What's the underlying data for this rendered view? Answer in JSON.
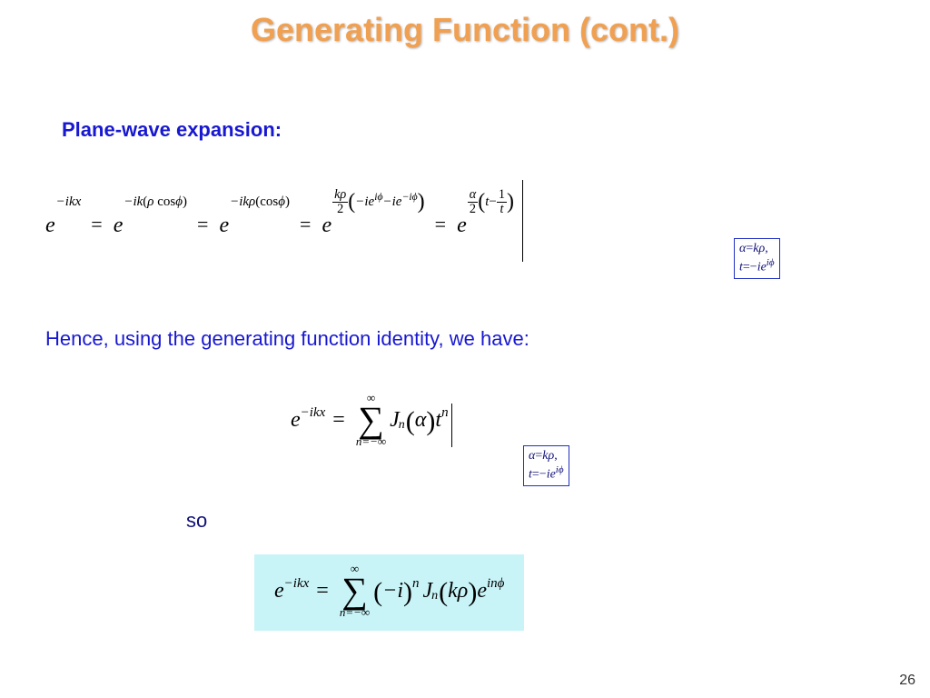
{
  "title": "Generating Function (cont.)",
  "subheading": "Plane-wave expansion:",
  "body_text": "Hence, using the generating function identity, we have:",
  "so": "so",
  "page_number": "26",
  "bullet": "",
  "eq1": {
    "t1_base": "e",
    "t1_exp": "−ikx",
    "eq": "=",
    "t2_base": "e",
    "t2_exp_a": "−ik",
    "t2_exp_b": "ρ",
    "t2_exp_c": "cos",
    "t2_exp_d": "ϕ",
    "t3_base": "e",
    "t3_exp_a": "−ikρ",
    "t3_exp_c": "cos",
    "t3_exp_d": "ϕ",
    "t4_base": "e",
    "t4_num": "kρ",
    "t4_den": "2",
    "t4_in1": "−ie",
    "t4_in1s": "iϕ",
    "t4_in2": "−ie",
    "t4_in2s": "−iϕ",
    "t5_base": "e",
    "t5_num": "α",
    "t5_den": "2",
    "t5_a": "t",
    "t5_b": "−",
    "t5_c": "1",
    "t5_d": "t"
  },
  "subbox": {
    "l1a": "α",
    "l1b": "=",
    "l1c": "k",
    "l1d": "ρ",
    "l1e": ",",
    "l2a": "t",
    "l2b": "=−",
    "l2c": "ie",
    "l2s": "iϕ"
  },
  "eq2": {
    "lhs_base": "e",
    "lhs_exp": "−ikx",
    "eq": "=",
    "sum_top": "∞",
    "sum_sig": "∑",
    "sum_bot": "n=−∞",
    "J": "J",
    "n": "n",
    "lp": "(",
    "alpha": "α",
    "rp": ")",
    "t": "t",
    "tn": "n"
  },
  "eq3": {
    "lhs_base": "e",
    "lhs_exp": "−ikx",
    "eq": "=",
    "sum_top": "∞",
    "sum_sig": "∑",
    "sum_bot": "n=−∞",
    "lp1": "(",
    "mi": "−i",
    "rp1": ")",
    "pn": "n",
    "J": "J",
    "n": "n",
    "lp2": "(",
    "krho": "kρ",
    "rp2": ")",
    "e": "e",
    "eexp": "inϕ"
  }
}
